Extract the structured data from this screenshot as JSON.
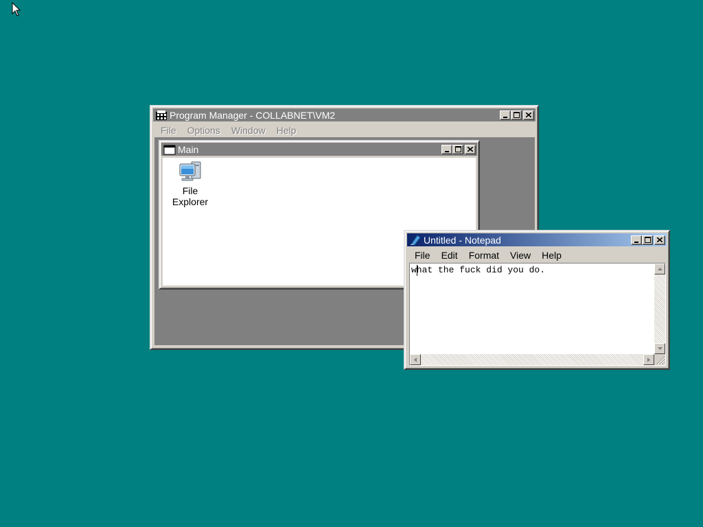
{
  "program_manager": {
    "title": "Program Manager - COLLABNET\\VM2",
    "menu": [
      "File",
      "Options",
      "Window",
      "Help"
    ],
    "main_group": {
      "title": "Main",
      "icons": [
        {
          "label_line1": "File",
          "label_line2": "Explorer",
          "icon": "computer-icon"
        }
      ]
    }
  },
  "notepad": {
    "title": "Untitled - Notepad",
    "menu": [
      "File",
      "Edit",
      "Format",
      "View",
      "Help"
    ],
    "content": "what the fuck did you do."
  },
  "colors": {
    "desktop": "#008080",
    "active_title": "#0a246a",
    "inactive_title": "#808080"
  }
}
